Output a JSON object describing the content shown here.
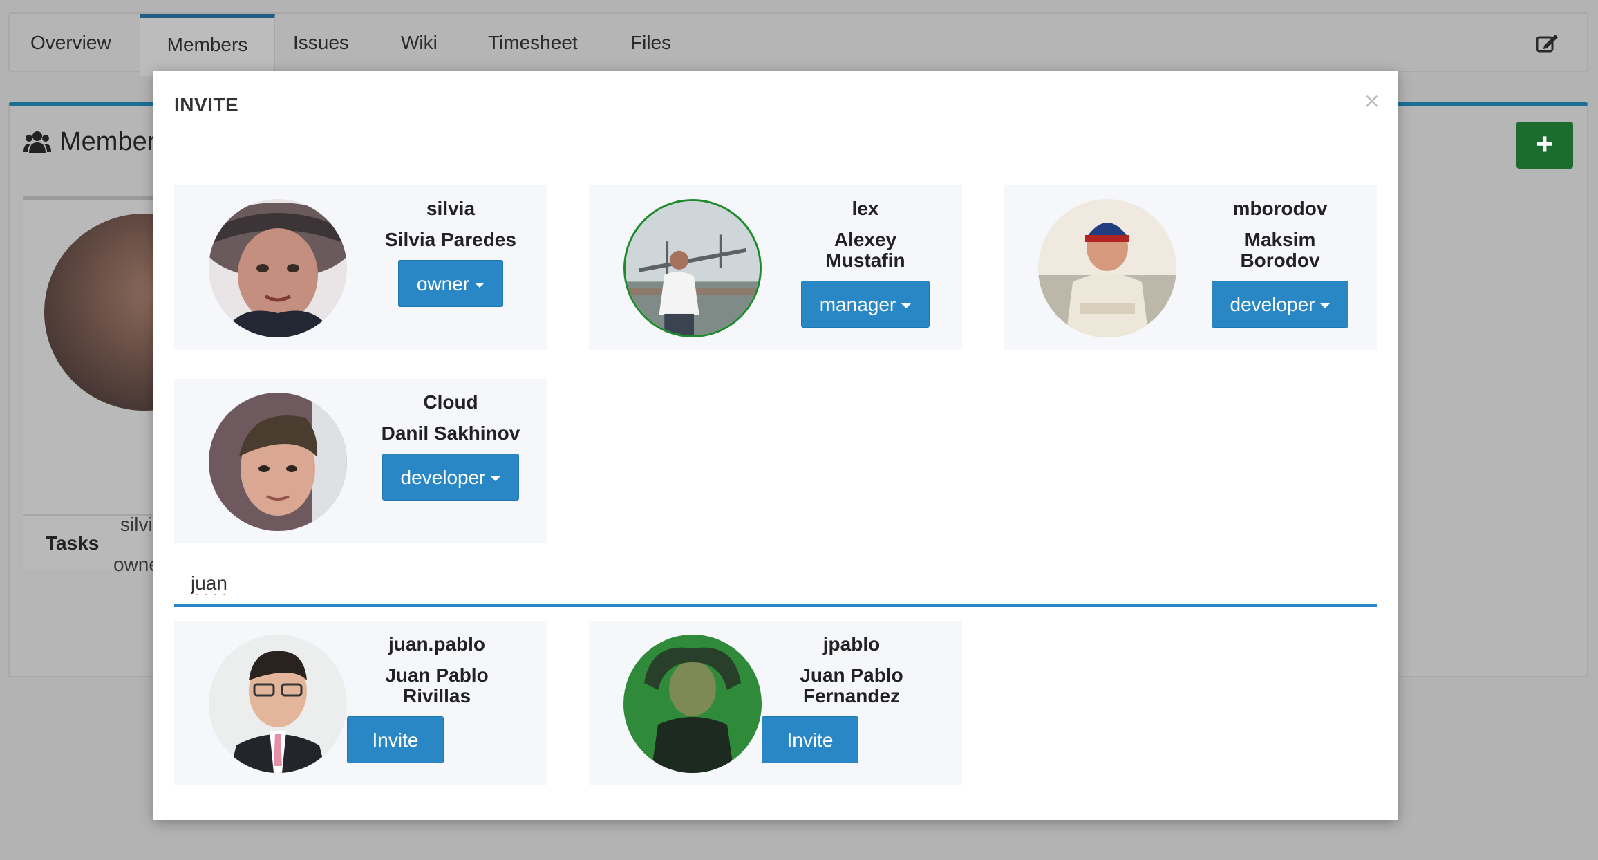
{
  "tabs": [
    {
      "label": "Overview"
    },
    {
      "label": "Members"
    },
    {
      "label": "Issues"
    },
    {
      "label": "Wiki"
    },
    {
      "label": "Timesheet"
    },
    {
      "label": "Files"
    }
  ],
  "panel": {
    "title": "Members",
    "add_label": "+",
    "card_name": "silvia",
    "card_role": "owne",
    "tasks_label": "Tasks"
  },
  "modal": {
    "title": "INVITE",
    "close": "×",
    "members": [
      {
        "username": "silvia",
        "fullname": "Silvia Paredes",
        "role": "owner"
      },
      {
        "username": "lex",
        "fullname": "Alexey Mustafin",
        "role": "manager"
      },
      {
        "username": "mborodov",
        "fullname": "Maksim Borodov",
        "role": "developer"
      },
      {
        "username": "Cloud",
        "fullname": "Danil Sakhinov",
        "role": "developer"
      }
    ],
    "search": {
      "value": "juan"
    },
    "results": [
      {
        "username": "juan.pablo",
        "fullname": "Juan Pablo Rivillas",
        "action": "Invite"
      },
      {
        "username": "jpablo",
        "fullname": "Juan Pablo Fernandez",
        "action": "Invite"
      }
    ]
  },
  "colors": {
    "accent": "#2a87c6",
    "add_button": "#1c6c2e",
    "overlay": "#b3b3b3"
  }
}
